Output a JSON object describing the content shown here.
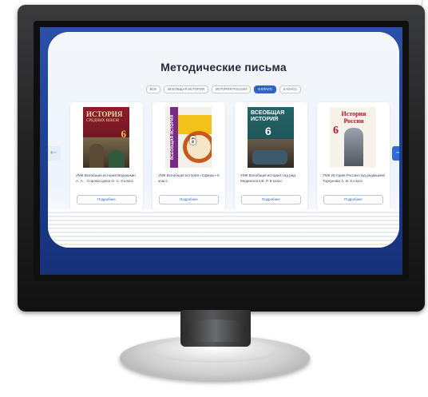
{
  "page": {
    "title": "Методические письма"
  },
  "filters": [
    {
      "label": "ВСЕ",
      "active": false
    },
    {
      "label": "ВСЕОБЩАЯ ИСТОРИЯ",
      "active": false
    },
    {
      "label": "ИСТОРИЯ РОССИИ",
      "active": false
    },
    {
      "label": "6 КЛАСС",
      "active": true
    },
    {
      "label": "5 КЛАСС",
      "active": false
    }
  ],
  "cards": [
    {
      "description": "УМК Всеобщая история Ведюшкин А. А. · Сорока-Цюпа О. С. 6 класс",
      "button_label": "Подробнее",
      "cover": {
        "line1": "ИСТОРИЯ",
        "line2": "СРЕДНИХ ВЕКОВ",
        "number": "6"
      }
    },
    {
      "description": "УМК Всеобщая история «Сферы» 6 класс",
      "button_label": "Подробнее",
      "cover": {
        "line1": "ВСЕОБЩАЯ ИСТОРИЯ",
        "number": "6"
      }
    },
    {
      "description": "УМК Всеобщая история под ред. Мединского В. Р. 6 класс",
      "button_label": "Подробнее",
      "cover": {
        "line1": "ВСЕОБЩАЯ ИСТОРИЯ",
        "number": "6"
      }
    },
    {
      "description": "УМК История России под редакцией Торкунова А. В. 6 класс",
      "button_label": "Подробнее",
      "cover": {
        "line1": "История России",
        "number": "6"
      }
    }
  ],
  "nav": {
    "prev_icon": "←",
    "next_icon": "→"
  },
  "colors": {
    "accent": "#2f63c9",
    "screen_bg": "#1d3d93",
    "panel_bg": "#eef4fb",
    "title_text": "#1e2a3d"
  },
  "icons": {
    "prev": "arrow-left-icon",
    "next": "arrow-right-icon"
  }
}
